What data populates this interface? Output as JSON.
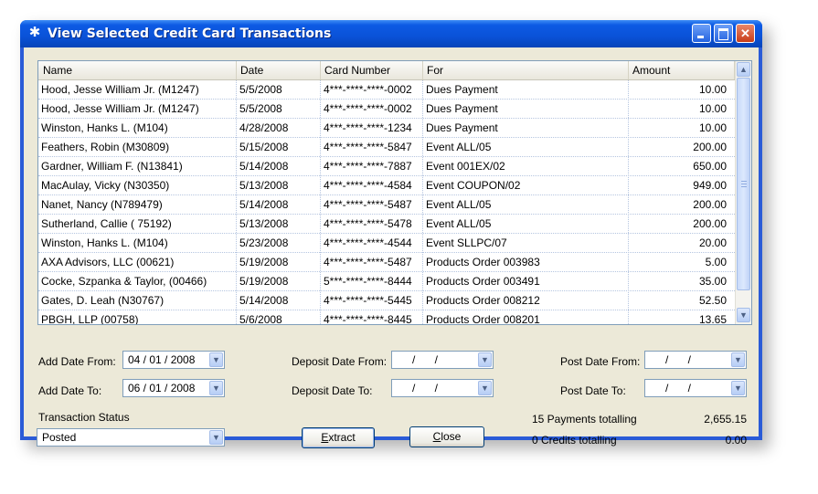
{
  "window": {
    "title": "View Selected Credit Card Transactions"
  },
  "table": {
    "headers": {
      "name": "Name",
      "date": "Date",
      "card": "Card Number",
      "for": "For",
      "amount": "Amount"
    },
    "rows": [
      {
        "name": "Hood, Jesse William Jr. (M1247)",
        "date": "5/5/2008",
        "card": "4***-****-****-0002",
        "for": "Dues Payment",
        "amount": "10.00"
      },
      {
        "name": "Hood, Jesse William Jr. (M1247)",
        "date": "5/5/2008",
        "card": "4***-****-****-0002",
        "for": "Dues Payment",
        "amount": "10.00"
      },
      {
        "name": "Winston, Hanks L. (M104)",
        "date": "4/28/2008",
        "card": "4***-****-****-1234",
        "for": "Dues Payment",
        "amount": "10.00"
      },
      {
        "name": "Feathers, Robin (M30809)",
        "date": "5/15/2008",
        "card": "4***-****-****-5847",
        "for": "Event ALL/05",
        "amount": "200.00"
      },
      {
        "name": "Gardner, William F. (N13841)",
        "date": "5/14/2008",
        "card": "4***-****-****-7887",
        "for": "Event 001EX/02",
        "amount": "650.00"
      },
      {
        "name": "MacAulay, Vicky (N30350)",
        "date": "5/13/2008",
        "card": "4***-****-****-4584",
        "for": "Event COUPON/02",
        "amount": "949.00"
      },
      {
        "name": "Nanet, Nancy (N789479)",
        "date": "5/14/2008",
        "card": "4***-****-****-5487",
        "for": "Event ALL/05",
        "amount": "200.00"
      },
      {
        "name": "Sutherland, Callie ( 75192)",
        "date": "5/13/2008",
        "card": "4***-****-****-5478",
        "for": "Event ALL/05",
        "amount": "200.00"
      },
      {
        "name": "Winston, Hanks L. (M104)",
        "date": "5/23/2008",
        "card": "4***-****-****-4544",
        "for": "Event SLLPC/07",
        "amount": "20.00"
      },
      {
        "name": "AXA Advisors, LLC (00621)",
        "date": "5/19/2008",
        "card": "4***-****-****-5487",
        "for": "Products Order 003983",
        "amount": "5.00"
      },
      {
        "name": "Cocke, Szpanka & Taylor, (00466)",
        "date": "5/19/2008",
        "card": "5***-****-****-8444",
        "for": "Products Order 003491",
        "amount": "35.00"
      },
      {
        "name": "Gates, D. Leah (N30767)",
        "date": "5/14/2008",
        "card": "4***-****-****-5445",
        "for": "Products Order 008212",
        "amount": "52.50"
      },
      {
        "name": "PBGH, LLP (00758)",
        "date": "5/6/2008",
        "card": "4***-****-****-8445",
        "for": "Products Order 008201",
        "amount": "13.65"
      }
    ]
  },
  "filters": {
    "add_date_from_label": "Add Date From:",
    "add_date_from_value": "04 / 01 / 2008",
    "add_date_to_label": "Add Date To:",
    "add_date_to_value": "06 / 01 / 2008",
    "deposit_date_from_label": "Deposit Date From:",
    "deposit_date_from_value": "/ /",
    "deposit_date_to_label": "Deposit Date To:",
    "deposit_date_to_value": "/ /",
    "post_date_from_label": "Post Date From:",
    "post_date_from_value": "/ /",
    "post_date_to_label": "Post Date To:",
    "post_date_to_value": "/ /",
    "status_label": "Transaction Status",
    "status_value": "Posted"
  },
  "buttons": {
    "extract_pre": "",
    "extract_key": "E",
    "extract_post": "xtract",
    "close_pre": "",
    "close_key": "C",
    "close_post": "lose"
  },
  "summary": {
    "payments_label": "15 Payments totalling",
    "payments_total": "2,655.15",
    "credits_label": "0 Credits totalling",
    "credits_total": "0.00"
  },
  "colors": {
    "title_bar": "#0a52d8",
    "window_bg": "#ece9d8",
    "row_divider": "#b5c5e0"
  },
  "icons": {
    "title": "gear-icon",
    "minimize": "minimize-icon",
    "maximize": "maximize-icon",
    "close": "close-icon",
    "dropdown": "chevron-down-icon",
    "scroll_up": "arrow-up-icon",
    "scroll_down": "arrow-down-icon"
  }
}
